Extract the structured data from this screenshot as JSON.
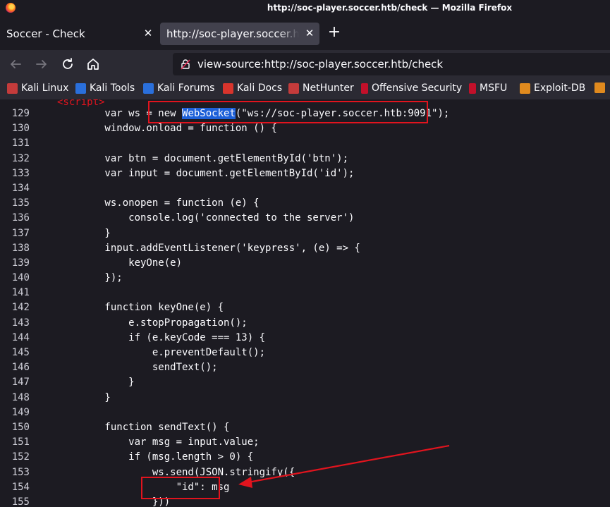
{
  "window": {
    "title": "http://soc-player.soccer.htb/check — Mozilla Firefox"
  },
  "tabs": [
    {
      "label": "Soccer - Check"
    },
    {
      "label": "http://soc-player.soccer.htb/check"
    }
  ],
  "toolbar": {
    "url": "view-source:http://soc-player.soccer.htb/check"
  },
  "bookmarks": [
    {
      "label": "Kali Linux",
      "icon": "kali-dragon-icon"
    },
    {
      "label": "Kali Tools",
      "icon": "kali-tools-icon"
    },
    {
      "label": "Kali Forums",
      "icon": "kali-forums-icon"
    },
    {
      "label": "Kali Docs",
      "icon": "kali-docs-icon"
    },
    {
      "label": "NetHunter",
      "icon": "kali-dragon-icon"
    },
    {
      "label": "Offensive Security",
      "icon": "offsec-icon"
    },
    {
      "label": "MSFU",
      "icon": "offsec-icon"
    },
    {
      "label": "Exploit-DB",
      "icon": "exploit-db-icon"
    }
  ],
  "source": {
    "partial_top": "<script>",
    "lines": [
      {
        "n": "129",
        "pre": "        var ws = new ",
        "hl": "WebSocket",
        "post": "(\"ws://soc-player.soccer.htb:9091\");"
      },
      {
        "n": "130",
        "text": "        window.onload = function () {"
      },
      {
        "n": "131",
        "text": ""
      },
      {
        "n": "132",
        "text": "        var btn = document.getElementById('btn');"
      },
      {
        "n": "133",
        "text": "        var input = document.getElementById('id');"
      },
      {
        "n": "134",
        "text": ""
      },
      {
        "n": "135",
        "text": "        ws.onopen = function (e) {"
      },
      {
        "n": "136",
        "text": "            console.log('connected to the server')"
      },
      {
        "n": "137",
        "text": "        }"
      },
      {
        "n": "138",
        "text": "        input.addEventListener('keypress', (e) => {"
      },
      {
        "n": "139",
        "text": "            keyOne(e)"
      },
      {
        "n": "140",
        "text": "        });"
      },
      {
        "n": "141",
        "text": ""
      },
      {
        "n": "142",
        "text": "        function keyOne(e) {"
      },
      {
        "n": "143",
        "text": "            e.stopPropagation();"
      },
      {
        "n": "144",
        "text": "            if (e.keyCode === 13) {"
      },
      {
        "n": "145",
        "text": "                e.preventDefault();"
      },
      {
        "n": "146",
        "text": "                sendText();"
      },
      {
        "n": "147",
        "text": "            }"
      },
      {
        "n": "148",
        "text": "        }"
      },
      {
        "n": "149",
        "text": ""
      },
      {
        "n": "150",
        "text": "        function sendText() {"
      },
      {
        "n": "151",
        "text": "            var msg = input.value;"
      },
      {
        "n": "152",
        "text": "            if (msg.length > 0) {"
      },
      {
        "n": "153",
        "text": "                ws.send(JSON.stringify({"
      },
      {
        "n": "154",
        "text": "                    \"id\": msg"
      },
      {
        "n": "155",
        "text": "                }))"
      }
    ]
  },
  "annotation_color": "#e1141e"
}
